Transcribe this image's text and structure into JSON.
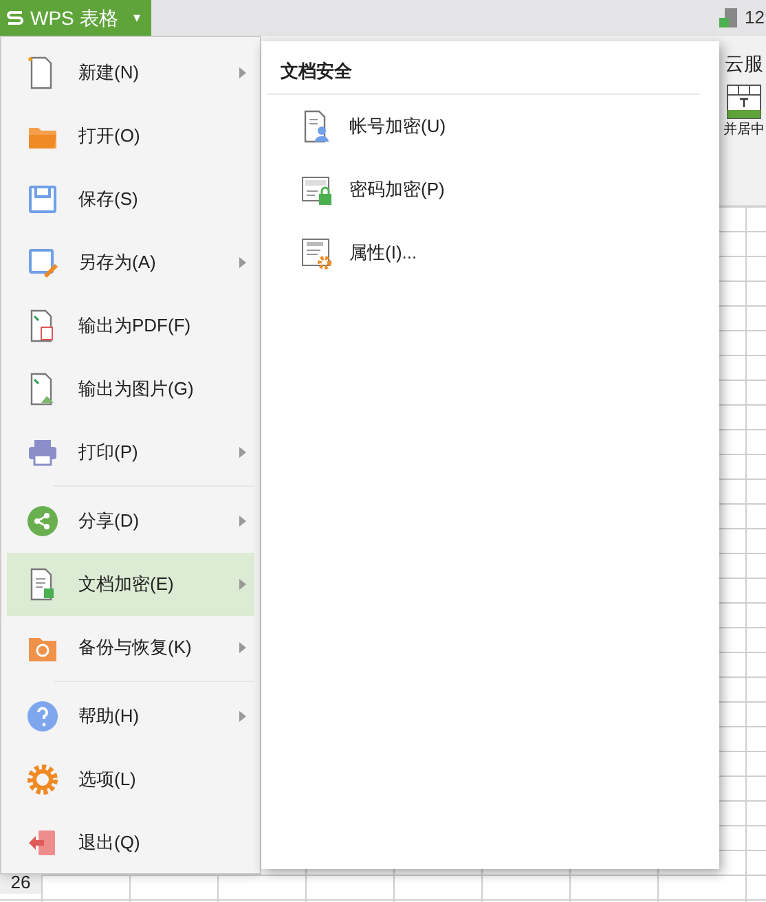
{
  "app_button": {
    "label": "WPS 表格",
    "caret": "▾"
  },
  "top_bar": {
    "file_count": "12"
  },
  "ribbon": {
    "cloud_tab": "云服",
    "merge_label": "并居中"
  },
  "row_header": "26",
  "file_menu": {
    "groups": [
      [
        {
          "label": "新建(N)",
          "submenu": true,
          "selected": false
        },
        {
          "label": "打开(O)",
          "submenu": false,
          "selected": false
        },
        {
          "label": "保存(S)",
          "submenu": false,
          "selected": false
        },
        {
          "label": "另存为(A)",
          "submenu": true,
          "selected": false
        },
        {
          "label": "输出为PDF(F)",
          "submenu": false,
          "selected": false
        },
        {
          "label": "输出为图片(G)",
          "submenu": false,
          "selected": false
        },
        {
          "label": "打印(P)",
          "submenu": true,
          "selected": false
        }
      ],
      [
        {
          "label": "分享(D)",
          "submenu": true,
          "selected": false
        },
        {
          "label": "文档加密(E)",
          "submenu": true,
          "selected": true
        },
        {
          "label": "备份与恢复(K)",
          "submenu": true,
          "selected": false
        }
      ],
      [
        {
          "label": "帮助(H)",
          "submenu": true,
          "selected": false
        },
        {
          "label": "选项(L)",
          "submenu": false,
          "selected": false
        },
        {
          "label": "退出(Q)",
          "submenu": false,
          "selected": false
        }
      ]
    ]
  },
  "submenu": {
    "title": "文档安全",
    "items": [
      {
        "label": "帐号加密(U)"
      },
      {
        "label": "密码加密(P)"
      },
      {
        "label": "属性(I)..."
      }
    ]
  }
}
